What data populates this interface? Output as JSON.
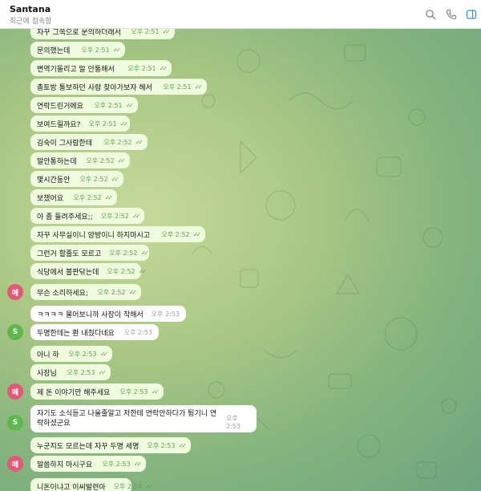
{
  "header": {
    "title": "Santana",
    "status": "최근에 접속함"
  },
  "icons": {
    "search": "search-icon",
    "call": "phone-icon",
    "sidebar": "sidebar-toggle-icon"
  },
  "colors": {
    "accent": "#3390ec",
    "outgoing_bubble": "#effdde",
    "incoming_bubble": "#ffffff",
    "avatar_me": "#e25876",
    "avatar_s": "#5fb84b"
  },
  "avatars": {
    "me": "메",
    "s": "S"
  },
  "messages": [
    {
      "text": "자꾸 그쪽으로 문의하더래서",
      "time": "오후 2:51",
      "dir": "out"
    },
    {
      "text": "문의했는데",
      "time": "오후 2:51",
      "dir": "out"
    },
    {
      "text": "변역기돌리고 말 안통해서",
      "time": "오후 2:51",
      "dir": "out"
    },
    {
      "text": "총토방 통보하던 사람 찾아가보자 해서",
      "time": "오후 2:51",
      "dir": "out"
    },
    {
      "text": "연락드린거에요",
      "time": "오후 2:51",
      "dir": "out"
    },
    {
      "text": "보여드릴까요?",
      "time": "오후 2:51",
      "dir": "out"
    },
    {
      "text": "김숙이 그사람한테",
      "time": "오후 2:52",
      "dir": "out"
    },
    {
      "text": "말안통하는데",
      "time": "오후 2:52",
      "dir": "out"
    },
    {
      "text": "몇시간동안",
      "time": "오후 2:52",
      "dir": "out"
    },
    {
      "text": "보챘어요",
      "time": "오후 2:52",
      "dir": "out"
    },
    {
      "text": "아 좀 들려주세요;;",
      "time": "오후 2:52",
      "dir": "out"
    },
    {
      "text": "자꾸 사무실이니 양방이니 하지마시고",
      "time": "오후 2:52",
      "dir": "out"
    },
    {
      "text": "그런거 할줄도 모르고",
      "time": "오후 2:52",
      "dir": "out"
    },
    {
      "text": "식당에서 불판닦는데",
      "time": "오후 2:52",
      "dir": "out"
    },
    {
      "text": "무슨 소리하세요;",
      "time": "오후 2:52",
      "dir": "out"
    },
    {
      "text": "ㅋㅋㅋㅋ 물어보니까 사장이 착해서",
      "time": "오후 2:53",
      "dir": "in"
    },
    {
      "text": "두명한테는 환 내줬다네요",
      "time": "오후 2:53",
      "dir": "in"
    },
    {
      "text": "아니 하",
      "time": "오후 2:53",
      "dir": "out"
    },
    {
      "text": "사장님",
      "time": "오후 2:53",
      "dir": "out"
    },
    {
      "text": "제 돈 이야기만 해주세요",
      "time": "오후 2:53",
      "dir": "out"
    },
    {
      "text": "자기도 소식듣고 나올줄알고 저한테 연락안하다가 튕기니 연락하셨군요",
      "time": "오후 2:53",
      "dir": "in"
    },
    {
      "text": "누군지도 모르는데 자꾸 두명 세명",
      "time": "오후 2:53",
      "dir": "out"
    },
    {
      "text": "말씀하지 마시구요",
      "time": "오후 2:53",
      "dir": "out"
    },
    {
      "text": "니돈이냐고 이씨발련아",
      "time": "오후 2:54",
      "dir": "out"
    }
  ]
}
